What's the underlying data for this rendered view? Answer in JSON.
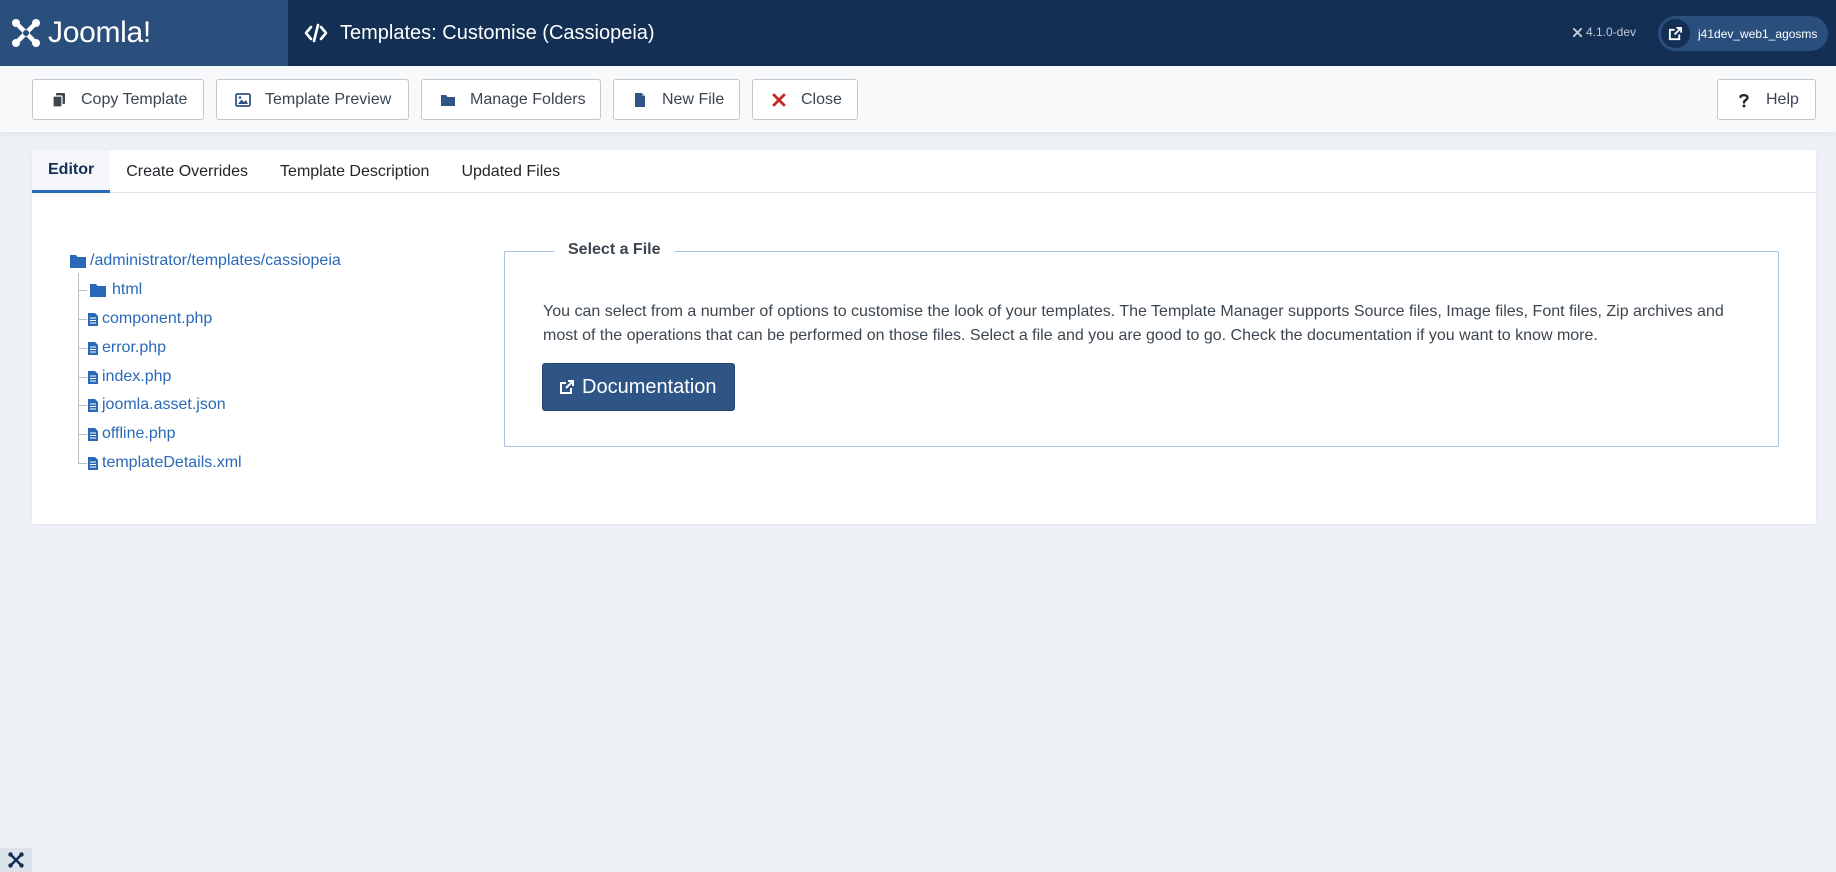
{
  "header": {
    "logo_text": "Joomla!",
    "page_title": "Templates: Customise (Cassiopeia)",
    "version": "4.1.0-dev",
    "user_label": "j41dev_web1_agosms"
  },
  "toolbar": {
    "copy_template": "Copy Template",
    "template_preview": "Template Preview",
    "manage_folders": "Manage Folders",
    "new_file": "New File",
    "close": "Close",
    "help": "Help"
  },
  "tabs": [
    "Editor",
    "Create Overrides",
    "Template Description",
    "Updated Files"
  ],
  "tree": {
    "root": "/administrator/templates/cassiopeia",
    "folders": [
      "html"
    ],
    "files": [
      "component.php",
      "error.php",
      "index.php",
      "joomla.asset.json",
      "offline.php",
      "templateDetails.xml"
    ]
  },
  "select_file": {
    "legend": "Select a File",
    "description": "You can select from a number of options to customise the look of your templates. The Template Manager supports Source files, Image files, Font files, Zip archives and most of the operations that can be performed on those files. Select a file and you are good to go. Check the documentation if you want to know more.",
    "button": "Documentation"
  },
  "colors": {
    "header_bg": "#132f53",
    "logo_bg": "#2a4f7d",
    "link": "#2a69b8",
    "primary_button": "#2e5586",
    "close_icon": "#c52827"
  }
}
